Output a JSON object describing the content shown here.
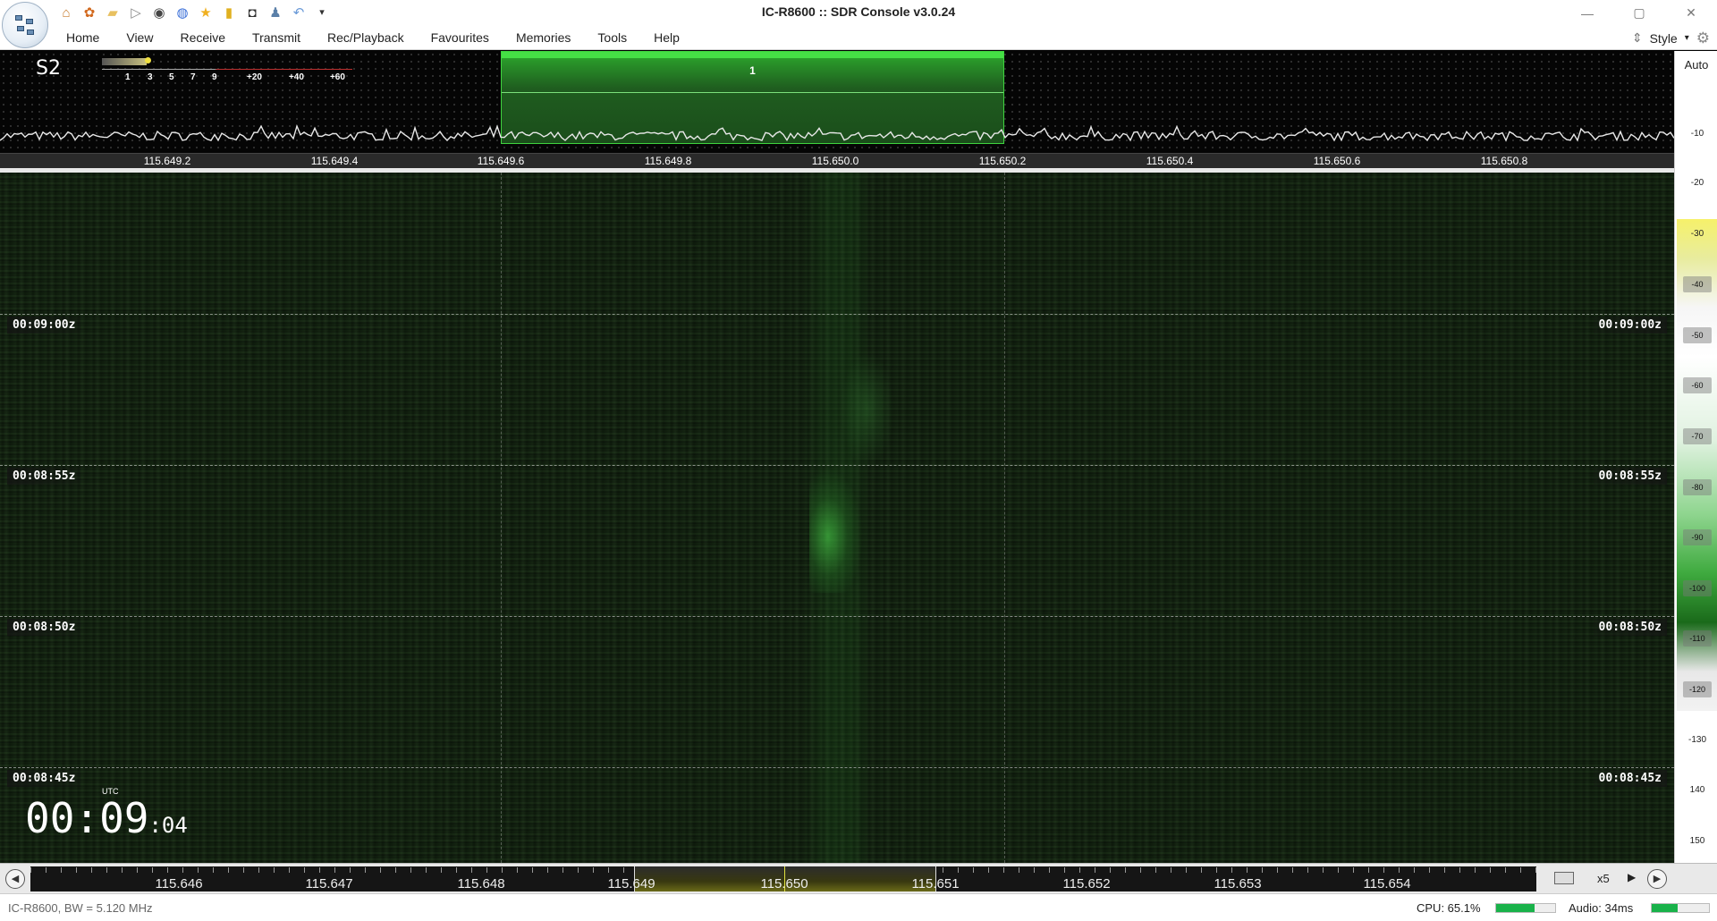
{
  "window": {
    "title": "IC-R8600 :: SDR Console v3.0.24",
    "controls": {
      "minimize": "—",
      "maximize": "▢",
      "close": "✕"
    }
  },
  "quick_access_icons": [
    "home-icon",
    "settings-icon",
    "folder-icon",
    "play-icon",
    "stop-icon",
    "globe-icon",
    "star-icon",
    "lock-icon",
    "camera-icon",
    "user-icon",
    "undo-icon",
    "dropdown-icon"
  ],
  "menu": {
    "items": [
      "Home",
      "View",
      "Receive",
      "Transmit",
      "Rec/Playback",
      "Favourites",
      "Memories",
      "Tools",
      "Help"
    ],
    "style_label": "Style"
  },
  "spectrum": {
    "smeter_reading": "S2",
    "smeter_scale": [
      "1",
      "3",
      "5",
      "7",
      "9",
      "+20",
      "+40",
      "+60"
    ],
    "vfo_label": "1",
    "freq_labels": [
      "115.649.2",
      "115.649.4",
      "115.649.6",
      "115.649.8",
      "115.650.0",
      "115.650.2",
      "115.650.4",
      "115.650.6",
      "115.650.8"
    ]
  },
  "db_scale": {
    "auto_label": "Auto",
    "ticks": [
      "-10",
      "-20",
      "-30",
      "-40",
      "-50",
      "-60",
      "-70",
      "-80",
      "-90",
      "-100",
      "-110",
      "-120",
      "-130",
      "140",
      "150"
    ]
  },
  "waterfall": {
    "time_markers": [
      "00:09:00z",
      "00:08:55z",
      "00:08:50z",
      "00:08:45z"
    ],
    "utc_label": "UTC",
    "clock_main": "00:09",
    "clock_seconds": ":04"
  },
  "bottom_ruler": {
    "freq_labels": [
      "115.646",
      "115.647",
      "115.648",
      "115.649",
      "115.650",
      "115.651",
      "115.652",
      "115.653",
      "115.654"
    ],
    "zoom_level": "x5",
    "highlight_color": "#e0e040"
  },
  "status": {
    "device": "IC-R8600, BW = 5.120 MHz",
    "cpu_label": "CPU: 65.1%",
    "cpu_value": 65.1,
    "audio_label": "Audio: 34ms",
    "audio_fraction": 0.45,
    "meter_color": "#19b24a"
  },
  "colors": {
    "passband": "#2a9a2a",
    "waterfall_base": "#0e1a0c"
  }
}
